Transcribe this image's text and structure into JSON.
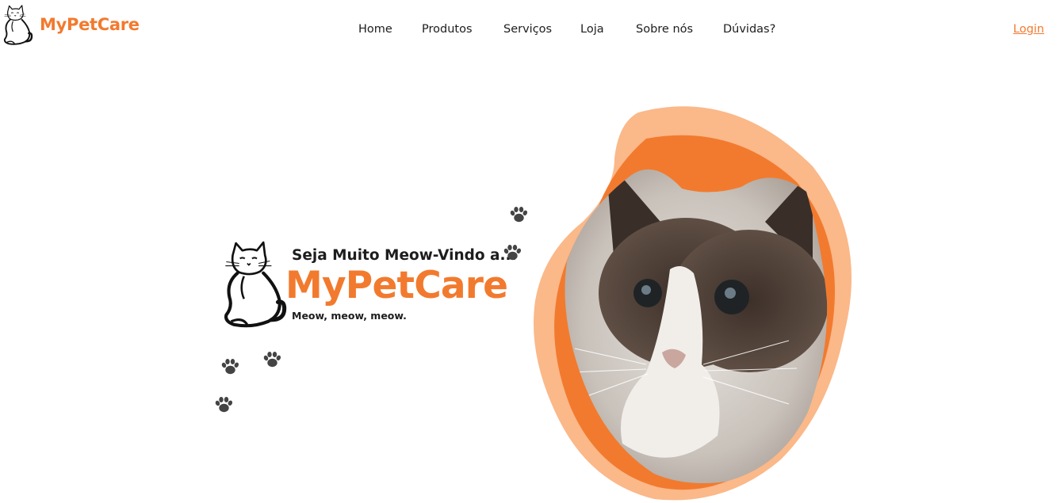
{
  "nav": {
    "brand": "MyPetCare",
    "links": [
      "Home",
      "Produtos",
      "Serviços",
      "Loja",
      "Sobre nós",
      "Dúvidas?"
    ],
    "login": "Login"
  },
  "hero": {
    "welcome": "Seja Muito Meow-Vindo a...",
    "brand": "MyPetCare",
    "tagline": "Meow, meow, meow."
  },
  "icons": {
    "logo": "cat-logo-icon",
    "paw": "paw-print-icon",
    "photo": "cat-photo"
  },
  "colors": {
    "accent": "#f27a2e",
    "blob_light": "#fbb889",
    "text": "#1d1d1d",
    "paw": "#444444"
  }
}
